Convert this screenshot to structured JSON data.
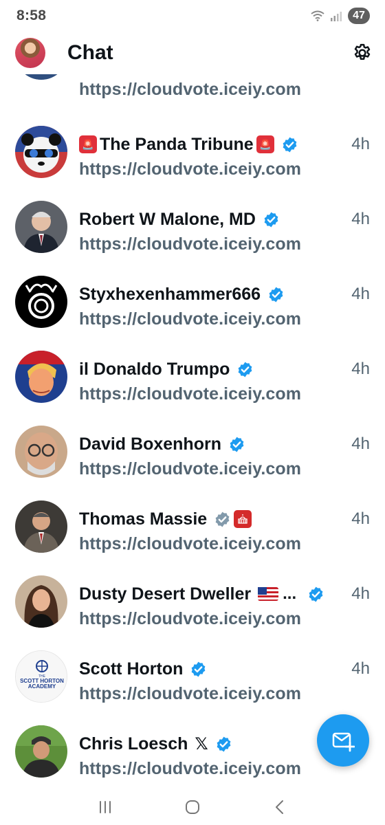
{
  "status_bar": {
    "time": "8:58",
    "battery": "47"
  },
  "header": {
    "title": "Chat"
  },
  "colors": {
    "accent": "#1d9bf0",
    "text_primary": "#0f1419",
    "text_secondary": "#536471"
  },
  "chats": [
    {
      "name": "",
      "time": "",
      "message": "https://cloudvote.iceiy.com"
    },
    {
      "name": "The Panda Tribune",
      "time": "4h",
      "message": "https://cloudvote.iceiy.com",
      "badges": [
        "siren-emoji",
        "siren-emoji",
        "verified-badge"
      ]
    },
    {
      "name": "Robert W Malone, MD",
      "time": "4h",
      "message": "https://cloudvote.iceiy.com",
      "badges": [
        "verified-badge"
      ]
    },
    {
      "name": "Styxhexenhammer666",
      "time": "4h",
      "message": "https://cloudvote.iceiy.com",
      "badges": [
        "verified-badge"
      ]
    },
    {
      "name": "il Donaldo Trumpo",
      "time": "4h",
      "message": "https://cloudvote.iceiy.com",
      "badges": [
        "verified-badge"
      ]
    },
    {
      "name": "David Boxenhorn",
      "time": "4h",
      "message": "https://cloudvote.iceiy.com",
      "badges": [
        "verified-badge"
      ]
    },
    {
      "name": "Thomas Massie",
      "time": "4h",
      "message": "https://cloudvote.iceiy.com",
      "badges": [
        "gray-verified-badge",
        "capitol-badge"
      ]
    },
    {
      "name": "Dusty Desert Dweller",
      "time": "4h",
      "message": "https://cloudvote.iceiy.com",
      "badges": [
        "us-flag-emoji",
        "verified-badge"
      ]
    },
    {
      "name": "Scott Horton",
      "time": "4h",
      "message": "https://cloudvote.iceiy.com",
      "badges": [
        "verified-badge"
      ]
    },
    {
      "name": "Chris Loesch",
      "time": "",
      "message": "https://cloudvote.iceiy.com",
      "badges": [
        "x-logo",
        "verified-badge"
      ]
    }
  ],
  "avatar_texts": {
    "scott_horton_line1": "THE",
    "scott_horton_line2": "SCOTT HORTON",
    "scott_horton_line3": "ACADEMY"
  },
  "ellipsis": "...",
  "x_logo_glyph": "𝕏"
}
